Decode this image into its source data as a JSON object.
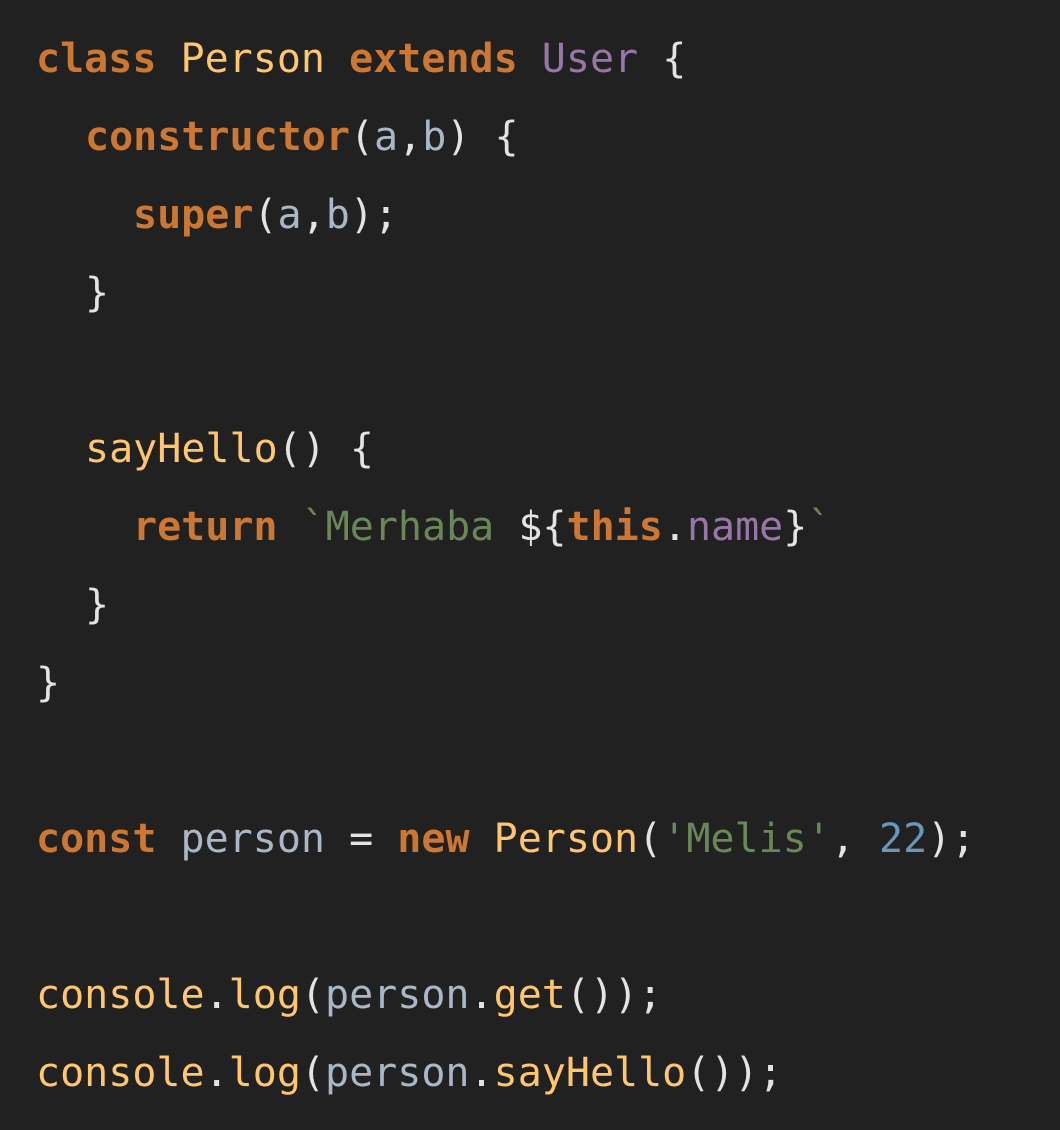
{
  "code": {
    "l1": {
      "kw_class": "class",
      "class_name": "Person",
      "kw_extends": "extends",
      "super_class": "User",
      "brace": "{"
    },
    "l2": {
      "method": "constructor",
      "open": "(",
      "p1": "a",
      "comma": ",",
      "p2": "b",
      "close": ")",
      "brace": "{"
    },
    "l3": {
      "kw_super": "super",
      "open": "(",
      "p1": "a",
      "comma": ",",
      "p2": "b",
      "close": ");"
    },
    "l4": {
      "brace": "}"
    },
    "l6": {
      "method": "sayHello",
      "parens": "()",
      "brace": "{"
    },
    "l7": {
      "kw_return": "return",
      "tpl_open": "`Merhaba ",
      "interp_open": "${",
      "kw_this": "this",
      "dot": ".",
      "prop": "name",
      "interp_close": "}",
      "tpl_close": "`"
    },
    "l8": {
      "brace": "}"
    },
    "l9": {
      "brace": "}"
    },
    "l11": {
      "kw_const": "const",
      "var": "person",
      "eq": "=",
      "kw_new": "new",
      "ctor": "Person",
      "open": "(",
      "str": "'Melis'",
      "comma": ",",
      "num": "22",
      "close": ");"
    },
    "l13": {
      "obj": "console",
      "dot": ".",
      "fn": "log",
      "open": "(",
      "arg": "person",
      "dot2": ".",
      "call": "get",
      "close": "());"
    },
    "l14": {
      "obj": "console",
      "dot": ".",
      "fn": "log",
      "open": "(",
      "arg": "person",
      "dot2": ".",
      "call": "sayHello",
      "close": "());"
    }
  },
  "colors": {
    "background": "#212121",
    "keyword": "#cc7832",
    "function": "#ffc66d",
    "class_ref": "#9876aa",
    "variable": "#a9b7c6",
    "string": "#6a8759",
    "number": "#6897bb",
    "punctuation": "#e3e3e3"
  }
}
